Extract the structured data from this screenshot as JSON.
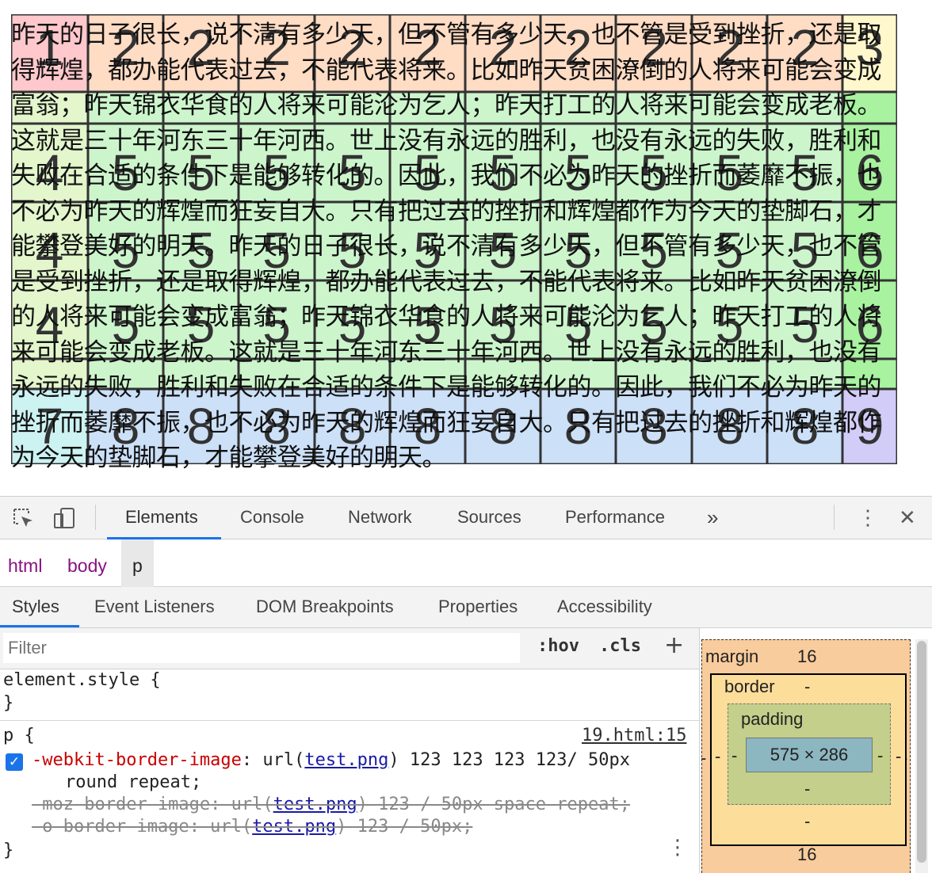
{
  "page": {
    "paragraph": "昨天的日子很长，说不清有多少天，但不管有多少天，也不管是受到挫折，还是取得辉煌，都办能代表过去，不能代表将来。比如昨天贫困潦倒的人将来可能会变成富翁；昨天锦衣华食的人将来可能沦为乞人；昨天打工的人将来可能会变成老板。这就是三十年河东三十年河西。世上没有永远的胜利，也没有永远的失败，胜利和失败在合适的条件下是能够转化的。因此，我们不必为昨天的挫折而萎靡不振，也不必为昨天的辉煌而狂妄自大。只有把过去的挫折和辉煌都作为今天的垫脚石，才能攀登美好的明天。昨天的日子很长，说不清有多少天，但不管有多少天，也不管是受到挫折，还是取得辉煌，都办能代表过去，不能代表将来。比如昨天贫困潦倒的人将来可能会变成富翁；昨天锦衣华食的人将来可能沦为乞人；昨天打工的人将来可能会变成老板。这就是三十年河东三十年河西。世上没有永远的胜利，也没有永远的失败，胜利和失败在合适的条件下是能够转化的。因此，我们不必为昨天的挫折而萎靡不振，也不必为昨天的辉煌而狂妄自大。只有把过去的挫折和辉煌都作为今天的垫脚石，才能攀登美好的明天。",
    "tile_numbers": [
      "1",
      "2",
      "3",
      "4",
      "5",
      "6",
      "7",
      "8",
      "9"
    ],
    "tile_colors": {
      "1": "#ffc8cc",
      "2": "#ffdcc4",
      "3": "#fff8cc",
      "4": "#e3f6cc",
      "5": "#ccf5cc",
      "6": "#a8f2a0",
      "7": "#ccf2f2",
      "8": "#cce0f8",
      "9": "#d2ccf8"
    }
  },
  "devtools": {
    "tabs": [
      "Elements",
      "Console",
      "Network",
      "Sources",
      "Performance"
    ],
    "more_tabs": "»",
    "menu": "⋮",
    "close": "✕",
    "breadcrumb": [
      "html",
      "body",
      "p"
    ],
    "subtabs": [
      "Styles",
      "Event Listeners",
      "DOM Breakpoints",
      "Properties",
      "Accessibility"
    ],
    "filter_placeholder": "Filter",
    "hov": ":hov",
    "cls": ".cls",
    "add": "+",
    "element_style_open": "element.style {",
    "close_brace": "}",
    "rule_selector": "p {",
    "rule_source": "19.html:15",
    "decl1_name": "-webkit-border-image",
    "decl1_pre": ": url(",
    "decl1_link": "test.png",
    "decl1_post": ") 123 123 123 123/ 50px",
    "decl1_cont": "round repeat;",
    "decl2_name": "-moz-border-image",
    "decl2_pre": ": url(",
    "decl2_link": "test.png",
    "decl2_post": ") 123 / 50px space repeat;",
    "decl3_name": "-o-border-image",
    "decl3_pre": ": url(",
    "decl3_link": "test.png",
    "decl3_post": ") 123 / 50px;",
    "kebab": "⋮",
    "box_model": {
      "margin_label": "margin",
      "margin_top": "16",
      "margin_bottom": "16",
      "margin_side": "-",
      "border_label": "border",
      "border_top": "-",
      "border_bottom": "-",
      "border_side": "-",
      "padding_label": "padding",
      "padding_bottom": "-",
      "padding_side": "-",
      "content": "575 × 286"
    }
  }
}
